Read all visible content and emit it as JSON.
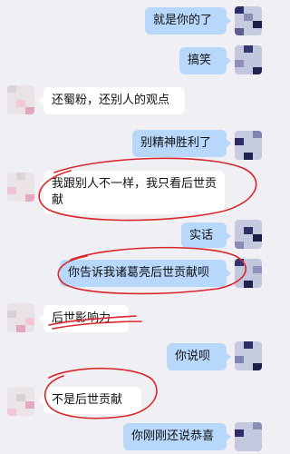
{
  "colors": {
    "background": "#efeff4",
    "my_bubble": "#b7d7fb",
    "their_bubble": "#ffffff",
    "annotation_ink": "#d9262a"
  },
  "messages": [
    {
      "side": "right",
      "text": "就是你的了"
    },
    {
      "side": "right",
      "text": "搞笑"
    },
    {
      "side": "left",
      "text": "还蜀粉，还别人的观点"
    },
    {
      "side": "right",
      "text": "别精神胜利了"
    },
    {
      "side": "left",
      "text": "我跟别人不一样，我只看后世贡献"
    },
    {
      "side": "right",
      "text": "实话"
    },
    {
      "side": "right",
      "text": "你告诉我诸葛亮后世贡献呗"
    },
    {
      "side": "left",
      "text": "后世影响力"
    },
    {
      "side": "right",
      "text": "你说呗"
    },
    {
      "side": "left",
      "text": "不是后世贡献"
    },
    {
      "side": "right",
      "text": "你刚刚还说恭喜"
    }
  ]
}
